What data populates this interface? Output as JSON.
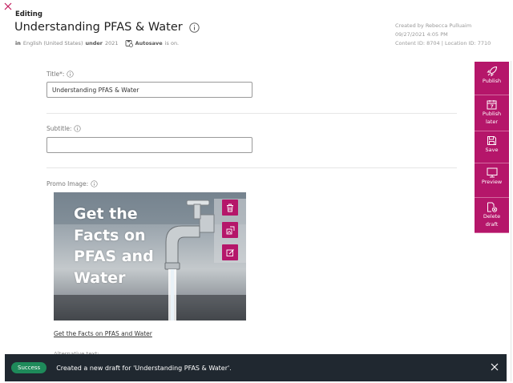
{
  "header": {
    "mode_label": "Editing",
    "title": "Understanding PFAS & Water",
    "meta": {
      "in_label": "in",
      "language": "English (United States)",
      "under_label": "under",
      "year": "2021",
      "autosave_label": "Autosave",
      "autosave_status": "is on."
    },
    "created_by": "Created by Rebecca Pulluaim",
    "created_date": "09/27/2021 4:05 PM",
    "ids": "Content ID: 8704 | Location ID: 7710"
  },
  "form": {
    "title_label": "Title*:",
    "title_value": "Understanding PFAS & Water",
    "subtitle_label": "Subtitle:",
    "subtitle_value": "",
    "promo_label": "Promo Image:",
    "promo_image_text": [
      "Get the",
      "Facts on",
      "PFAS and",
      "Water"
    ],
    "promo_link": "Get the Facts on PFAS and Water",
    "alt_text_label": "Alternative text:"
  },
  "toolbar": {
    "publish": "Publish",
    "publish_later": [
      "Publish",
      "later"
    ],
    "save": "Save",
    "preview": "Preview",
    "delete_draft": [
      "Delete",
      "draft"
    ]
  },
  "toast": {
    "badge": "Success",
    "message": "Created a new draft for 'Understanding PFAS & Water'."
  },
  "colors": {
    "accent": "#b5166a",
    "toast_bg": "#202830",
    "success": "#1e8a5a"
  }
}
